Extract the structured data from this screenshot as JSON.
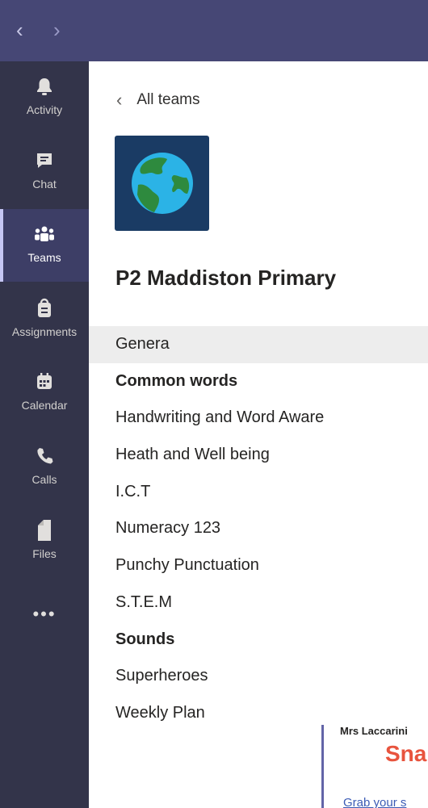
{
  "titlebar": {
    "back_glyph": "‹",
    "forward_glyph": "›"
  },
  "rail": {
    "items": [
      {
        "label": "Activity",
        "icon": "bell-icon"
      },
      {
        "label": "Chat",
        "icon": "chat-icon"
      },
      {
        "label": "Teams",
        "icon": "teams-icon",
        "active": true
      },
      {
        "label": "Assignments",
        "icon": "assignments-icon"
      },
      {
        "label": "Calendar",
        "icon": "calendar-icon"
      },
      {
        "label": "Calls",
        "icon": "phone-icon"
      },
      {
        "label": "Files",
        "icon": "file-icon"
      }
    ],
    "more": "•••"
  },
  "main": {
    "back_label": "All teams",
    "back_glyph": "‹",
    "team_name": "P2 Maddiston Primary",
    "team_logo_icon": "globe-icon",
    "channels": [
      {
        "label": "Genera",
        "selected": true,
        "bold": false
      },
      {
        "label": "Common words",
        "bold": true
      },
      {
        "label": "Handwriting and Word Aware",
        "bold": false
      },
      {
        "label": "Heath and Well being",
        "bold": false
      },
      {
        "label": "I.C.T",
        "bold": false
      },
      {
        "label": "Numeracy 123",
        "bold": false
      },
      {
        "label": "Punchy Punctuation",
        "bold": false
      },
      {
        "label": "S.T.E.M",
        "bold": false
      },
      {
        "label": "Sounds",
        "bold": true
      },
      {
        "label": "Superheroes",
        "bold": false
      },
      {
        "label": "Weekly Plan",
        "bold": false
      }
    ]
  },
  "preview": {
    "author": "Mrs Laccarini",
    "headline": "Sna",
    "link_text": "Grab your s"
  },
  "colors": {
    "titlebar": "#464775",
    "rail": "#33344a",
    "rail_active": "#3d3e66",
    "accent": "#6264a7",
    "logo_bg": "#1a3b64",
    "snap_red": "#e8543e"
  }
}
